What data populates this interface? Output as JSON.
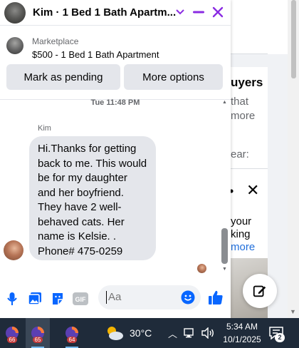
{
  "chat": {
    "title": "Kim · 1 Bed 1 Bath Apartm...",
    "marketplace_label": "Marketplace",
    "listing_title": "$500 - 1 Bed 1 Bath Apartment",
    "mark_pending_label": "Mark as pending",
    "more_options_label": "More options",
    "timestamp": "Tue 11:48 PM",
    "sender_name": "Kim",
    "message": "Hi.Thanks for getting back to me. This would be for my daughter and her boyfriend. They have 2 well-behaved cats. Her name is Kelsie. . Phone# 475-0259",
    "composer_placeholder": "Aa",
    "accent_color": "#8a2be2",
    "link_color": "#0866ff"
  },
  "background": {
    "title_fragment": "uyers",
    "line1": "that",
    "line2": "more",
    "line3": "ear:",
    "line4": "your",
    "line5": "king",
    "line6": "more"
  },
  "taskbar": {
    "apps": [
      {
        "badge": "66"
      },
      {
        "badge": "65"
      },
      {
        "badge": "64"
      }
    ],
    "temperature": "30°C",
    "time": "5:34 AM",
    "date": "10/1/2025",
    "notification_count": "2"
  },
  "icons": {
    "chevron": "chevron-down-icon",
    "minimize": "minimize-icon",
    "close": "close-icon",
    "mic": "microphone-icon",
    "image": "image-icon",
    "sticker": "sticker-icon",
    "gif": "gif-icon",
    "emoji": "emoji-icon",
    "like": "thumbs-up-icon",
    "compose": "compose-icon"
  }
}
